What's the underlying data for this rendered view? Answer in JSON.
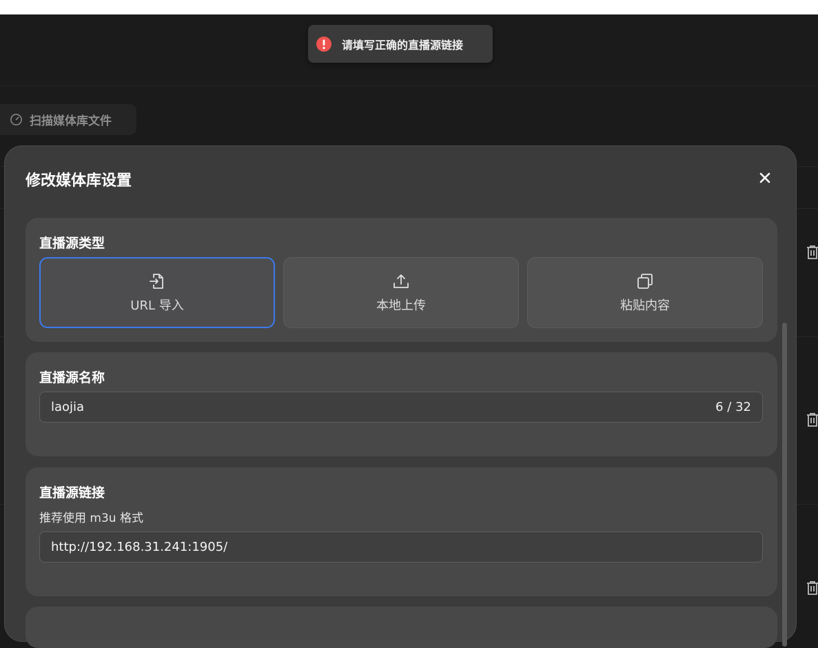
{
  "toast": {
    "icon": "error-icon",
    "message": "请填写正确的直播源链接",
    "color": "#ef5350"
  },
  "background": {
    "scan_button_label": "扫描媒体库文件"
  },
  "modal": {
    "title": "修改媒体库设置",
    "source_type": {
      "label": "直播源类型",
      "options": [
        {
          "label": "URL 导入",
          "icon": "file-import-icon",
          "selected": true
        },
        {
          "label": "本地上传",
          "icon": "upload-icon",
          "selected": false
        },
        {
          "label": "粘贴内容",
          "icon": "copy-icon",
          "selected": false
        }
      ]
    },
    "source_name": {
      "label": "直播源名称",
      "value": "laojia",
      "counter": "6 / 32"
    },
    "source_link": {
      "label": "直播源链接",
      "hint": "推荐使用 m3u 格式",
      "value": "http://192.168.31.241:1905/"
    }
  },
  "colors": {
    "accent": "#3d7bf0",
    "error": "#ef5350"
  }
}
